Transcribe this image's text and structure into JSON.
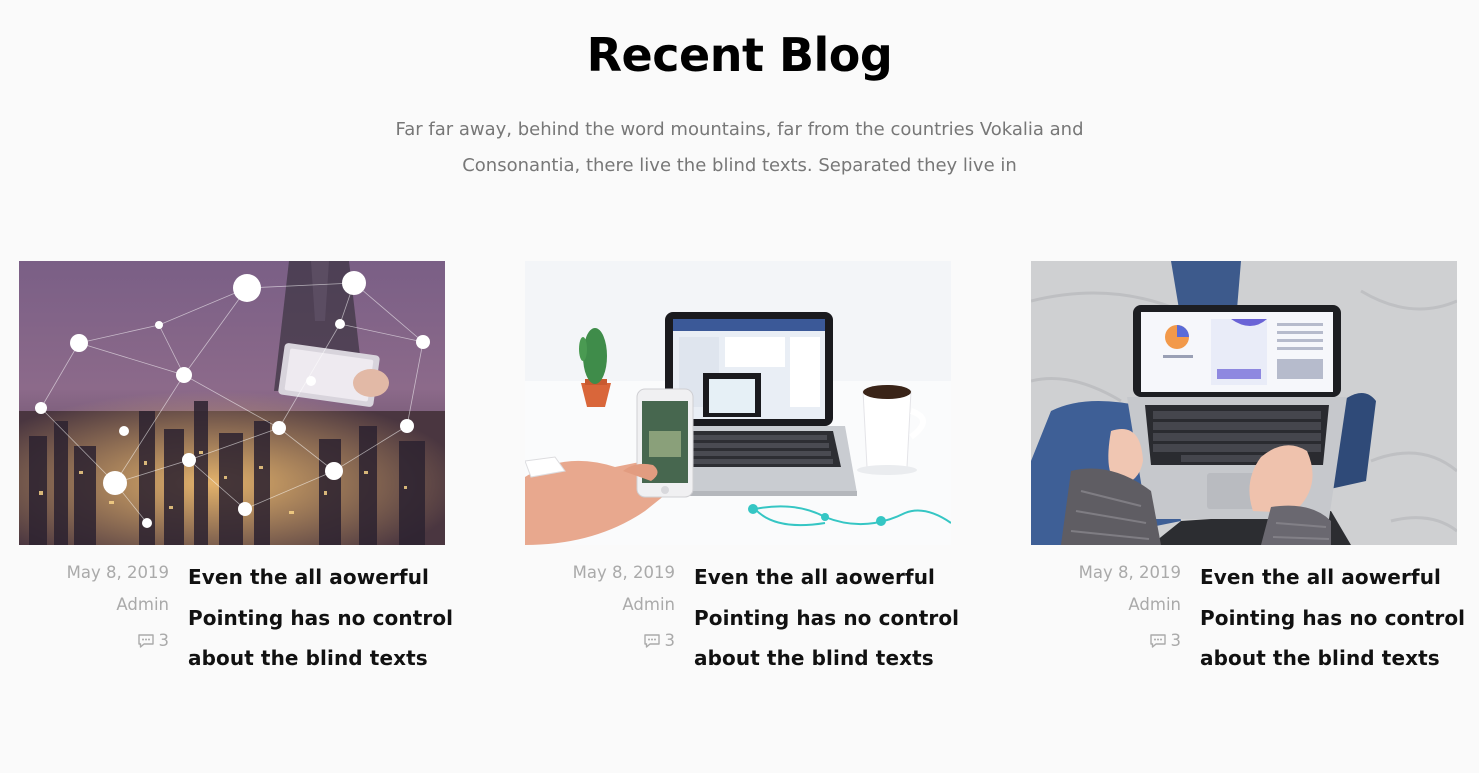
{
  "section": {
    "title": "Recent Blog",
    "subtitle": "Far far away, behind the word mountains, far from the countries Vokalia and Consonantia, there live the blind texts. Separated they live in"
  },
  "posts": [
    {
      "image_icon": "city-network-tablet-image",
      "date": "May 8, 2019",
      "author": "Admin",
      "comments": "3",
      "title": "Even the all aowerful Pointing has no control about the blind texts"
    },
    {
      "image_icon": "laptop-phone-desk-image",
      "date": "May 8, 2019",
      "author": "Admin",
      "comments": "3",
      "title": "Even the all aowerful Pointing has no control about the blind texts"
    },
    {
      "image_icon": "laptop-on-lap-image",
      "date": "May 8, 2019",
      "author": "Admin",
      "comments": "3",
      "title": "Even the all aowerful Pointing has no control about the blind texts"
    }
  ],
  "colors": {
    "background": "#fafafa",
    "meta_text": "#aaaaaa",
    "subtitle_text": "#777777",
    "title_text": "#111111"
  }
}
